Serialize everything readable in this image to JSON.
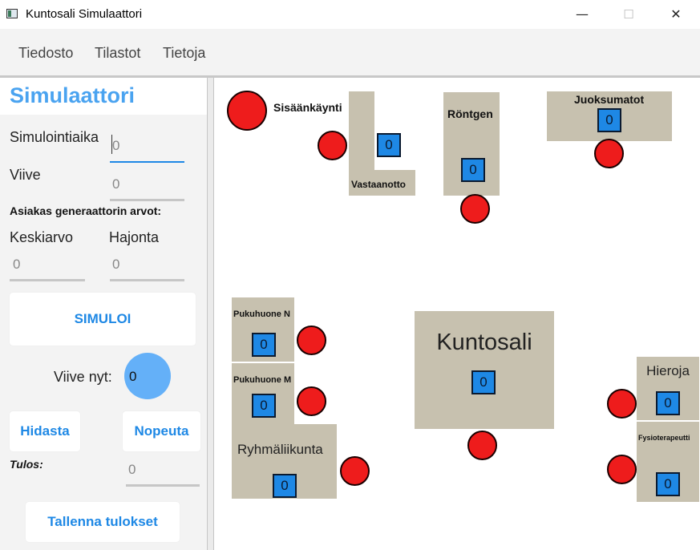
{
  "window": {
    "title": "Kuntosali Simulaattori",
    "minimize": "—",
    "maximize": "☐",
    "close": "✕"
  },
  "menu": [
    "Tiedosto",
    "Tilastot",
    "Tietoja"
  ],
  "panel": {
    "title": "Simulaattori",
    "sim_time_label": "Simulointiaika",
    "sim_time_value": "0",
    "delay_label": "Viive",
    "delay_value": "0",
    "generator_label": "Asiakas generaattorin arvot:",
    "mean_label": "Keskiarvo",
    "mean_value": "0",
    "stddev_label": "Hajonta",
    "stddev_value": "0",
    "simulate_button": "SIMULOI",
    "delay_now_label": "Viive nyt:",
    "delay_now_value": "0",
    "slower_button": "Hidasta",
    "faster_button": "Nopeuta",
    "result_label": "Tulos:",
    "result_value": "0",
    "save_button": "Tallenna tulokset"
  },
  "stations": {
    "entrance": {
      "label": "Sisäänkäynti"
    },
    "reception": {
      "label": "Vastaanotto",
      "count": "0"
    },
    "xray": {
      "label": "Röntgen",
      "count": "0"
    },
    "treadmills": {
      "label": "Juoksumatot",
      "count": "0"
    },
    "lockerN": {
      "label": "Pukuhuone N",
      "count": "0"
    },
    "lockerM": {
      "label": "Pukuhuone M",
      "count": "0"
    },
    "group": {
      "label": "Ryhmäliikunta",
      "count": "0"
    },
    "gym": {
      "label": "Kuntosali",
      "count": "0"
    },
    "masseur": {
      "label": "Hieroja",
      "count": "0"
    },
    "physio": {
      "label": "Fysioterapeutti",
      "count": "0"
    }
  },
  "colors": {
    "accent": "#1e88e5",
    "title_blue": "#4aa3f0",
    "station": "#c7c1af",
    "queue": "#ee1c1c",
    "delay_circle": "#64b0f8"
  }
}
